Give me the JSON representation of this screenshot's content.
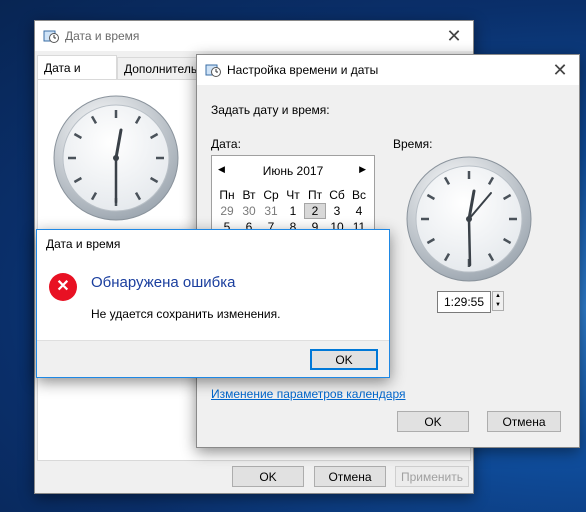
{
  "main_window": {
    "title": "Дата и время",
    "tabs": [
      {
        "label": "Дата и время",
        "selected": true
      },
      {
        "label": "Дополнительные часы",
        "selected": false
      }
    ],
    "buttons": {
      "ok": "OK",
      "cancel": "Отмена",
      "apply": "Применить"
    }
  },
  "settings_window": {
    "title": "Настройка времени и даты",
    "prompt": "Задать дату и время:",
    "date_label": "Дата:",
    "time_label": "Время:",
    "calendar": {
      "month_title": "Июнь 2017",
      "weekdays": [
        "Пн",
        "Вт",
        "Ср",
        "Чт",
        "Пт",
        "Сб",
        "Вс"
      ],
      "rows": [
        [
          "29",
          "30",
          "31",
          "1",
          "2",
          "3",
          "4"
        ],
        [
          "5",
          "6",
          "7",
          "8",
          "9",
          "10",
          "11"
        ]
      ],
      "selected_day": "2"
    },
    "time_value": "1:29:55",
    "calendar_link": "Изменение параметров календаря",
    "buttons": {
      "ok": "OK",
      "cancel": "Отмена"
    }
  },
  "error_dialog": {
    "title": "Дата и время",
    "heading": "Обнаружена ошибка",
    "message": "Не удается сохранить изменения.",
    "ok": "OK"
  },
  "colors": {
    "error_red": "#e81123",
    "heading_blue": "#1a3e9e",
    "link_blue": "#0066cc",
    "focus_blue": "#0078d7"
  },
  "icons": [
    "clock-calendar-icon",
    "close-icon",
    "error-icon",
    "arrow-left-icon",
    "arrow-right-icon",
    "spin-up-icon",
    "spin-down-icon"
  ]
}
